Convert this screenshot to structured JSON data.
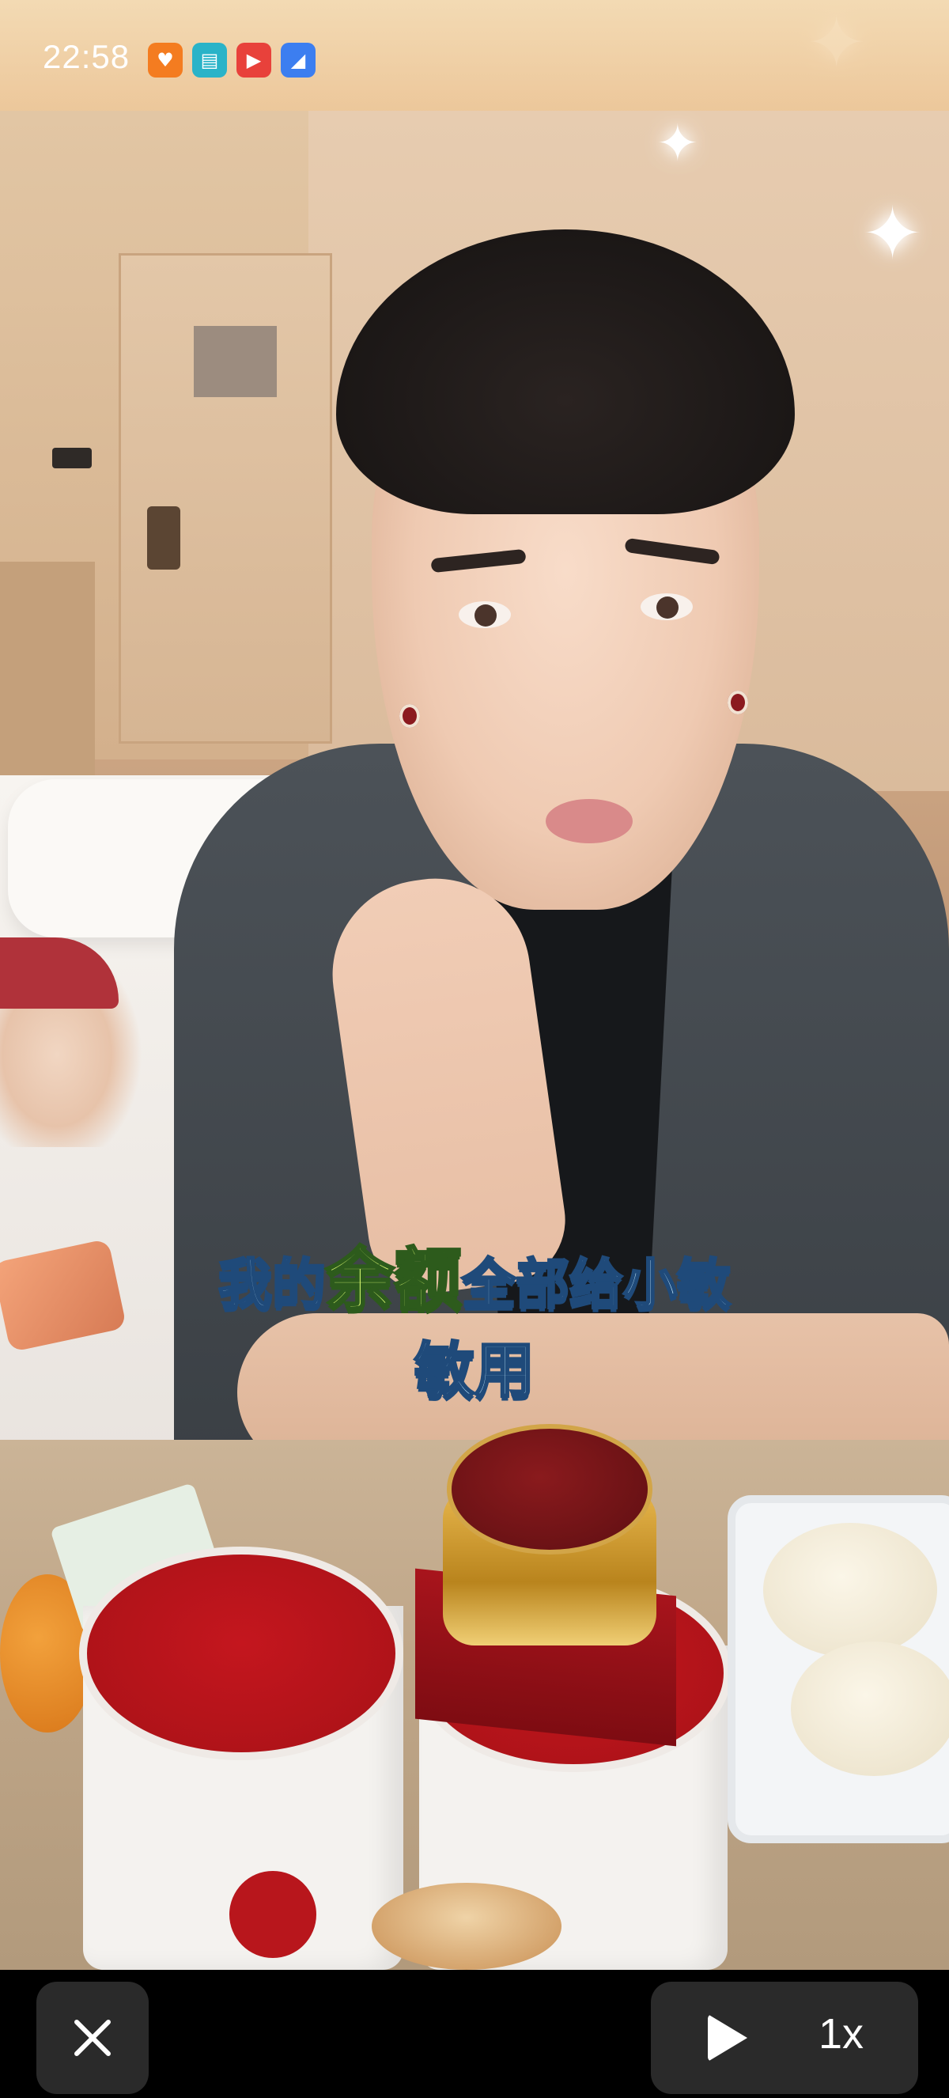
{
  "status_bar": {
    "time": "22:58",
    "icons": [
      {
        "name": "heart-app-icon",
        "color": "#f47c20"
      },
      {
        "name": "book-app-icon",
        "color": "#2ab3c8"
      },
      {
        "name": "video-app-icon",
        "color": "#e8413b"
      },
      {
        "name": "compass-app-icon",
        "color": "#3c7ef0"
      }
    ]
  },
  "caption": {
    "line1_part1": "我的",
    "line1_highlight": "余额",
    "line1_part2": "全部给小敏",
    "line2": "敏用"
  },
  "player": {
    "close_icon": "close-icon",
    "play_icon": "play-icon",
    "speed_label": "1x"
  }
}
